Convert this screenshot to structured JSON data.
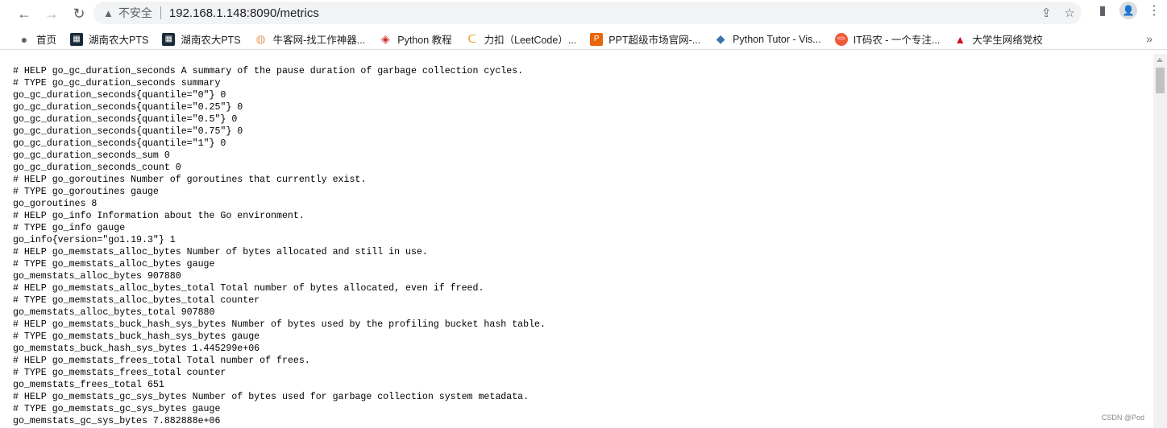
{
  "browser": {
    "security_label": "不安全",
    "url": "192.168.1.148:8090/metrics",
    "bookmarks": [
      {
        "label": "首页",
        "icon": "globe-icon",
        "color": "#5f6368"
      },
      {
        "label": "湖南农大PTS",
        "icon": "pts-icon",
        "color": "#1a2a3a"
      },
      {
        "label": "湖南农大PTS",
        "icon": "pts-icon",
        "color": "#1a2a3a"
      },
      {
        "label": "牛客网-找工作神器...",
        "icon": "nowcoder-icon",
        "color": "#e8a06a"
      },
      {
        "label": "Python 教程",
        "icon": "runoob-icon",
        "color": "#d0302a"
      },
      {
        "label": "力扣（LeetCode）...",
        "icon": "leetcode-icon",
        "color": "#f0a020"
      },
      {
        "label": "PPT超级市场官网-...",
        "icon": "ppt-icon",
        "color": "#e8650a"
      },
      {
        "label": "Python Tutor - Vis...",
        "icon": "python-icon",
        "color": "#3a75b0"
      },
      {
        "label": "IT码农 - 一个专注...",
        "icon": "code-icon",
        "color": "#f05a3a"
      },
      {
        "label": "大学生网络党校",
        "icon": "graduation-icon",
        "color": "#d0102a"
      }
    ]
  },
  "metrics_lines": [
    "# HELP go_gc_duration_seconds A summary of the pause duration of garbage collection cycles.",
    "# TYPE go_gc_duration_seconds summary",
    "go_gc_duration_seconds{quantile=\"0\"} 0",
    "go_gc_duration_seconds{quantile=\"0.25\"} 0",
    "go_gc_duration_seconds{quantile=\"0.5\"} 0",
    "go_gc_duration_seconds{quantile=\"0.75\"} 0",
    "go_gc_duration_seconds{quantile=\"1\"} 0",
    "go_gc_duration_seconds_sum 0",
    "go_gc_duration_seconds_count 0",
    "# HELP go_goroutines Number of goroutines that currently exist.",
    "# TYPE go_goroutines gauge",
    "go_goroutines 8",
    "# HELP go_info Information about the Go environment.",
    "# TYPE go_info gauge",
    "go_info{version=\"go1.19.3\"} 1",
    "# HELP go_memstats_alloc_bytes Number of bytes allocated and still in use.",
    "# TYPE go_memstats_alloc_bytes gauge",
    "go_memstats_alloc_bytes 907880",
    "# HELP go_memstats_alloc_bytes_total Total number of bytes allocated, even if freed.",
    "# TYPE go_memstats_alloc_bytes_total counter",
    "go_memstats_alloc_bytes_total 907880",
    "# HELP go_memstats_buck_hash_sys_bytes Number of bytes used by the profiling bucket hash table.",
    "# TYPE go_memstats_buck_hash_sys_bytes gauge",
    "go_memstats_buck_hash_sys_bytes 1.445299e+06",
    "# HELP go_memstats_frees_total Total number of frees.",
    "# TYPE go_memstats_frees_total counter",
    "go_memstats_frees_total 651",
    "# HELP go_memstats_gc_sys_bytes Number of bytes used for garbage collection system metadata.",
    "# TYPE go_memstats_gc_sys_bytes gauge",
    "go_memstats_gc_sys_bytes 7.882888e+06"
  ],
  "watermark": "CSDN @Pod"
}
